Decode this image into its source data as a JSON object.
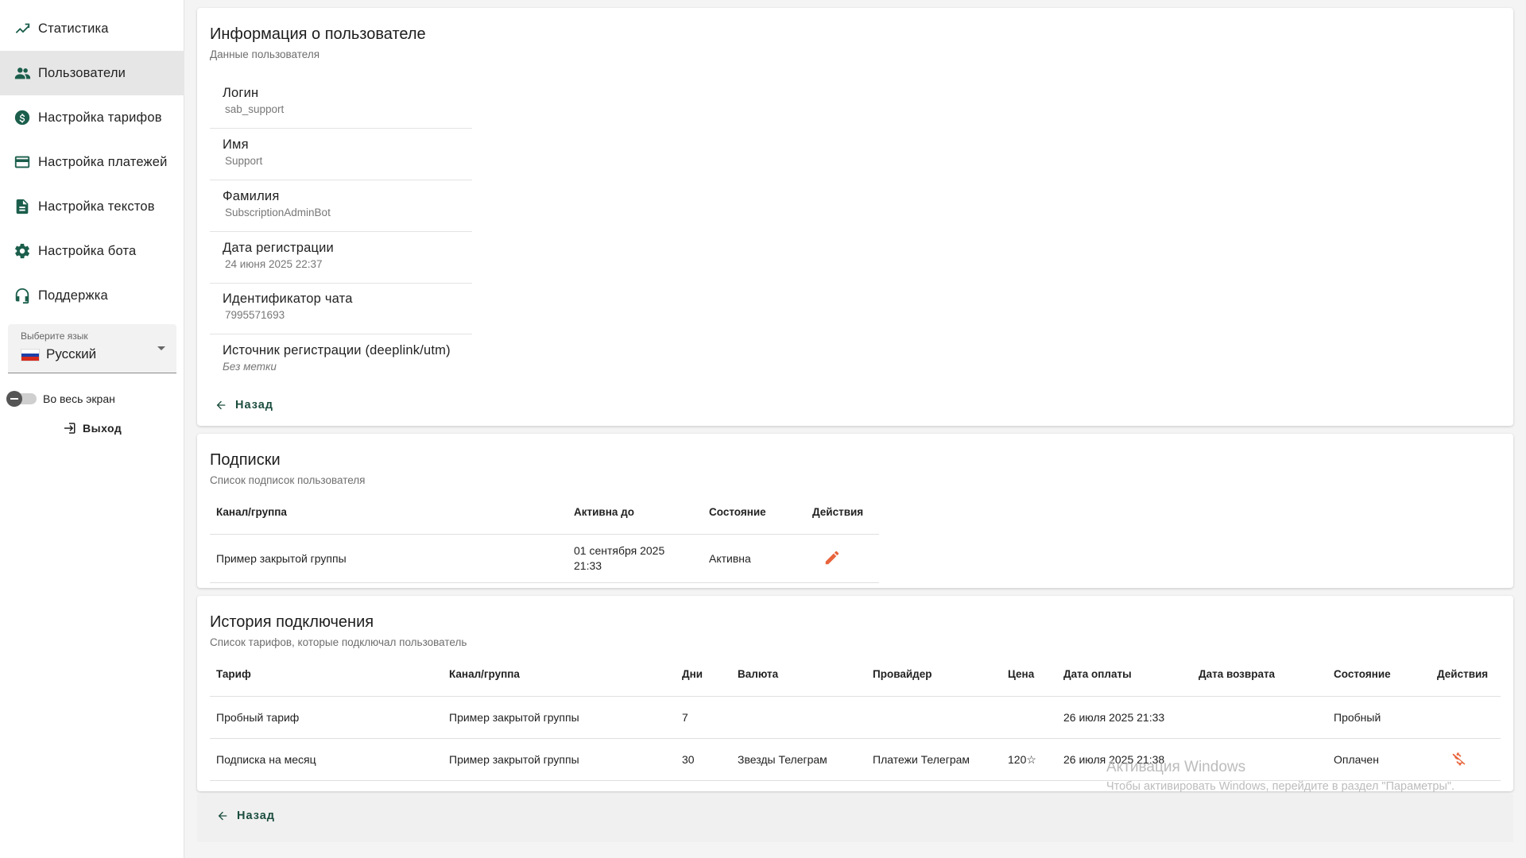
{
  "sidebar": {
    "items": [
      {
        "label": "Статистика",
        "icon": "chart-line-icon"
      },
      {
        "label": "Пользователи",
        "icon": "people-icon",
        "active": true
      },
      {
        "label": "Настройка тарифов",
        "icon": "dollar-circle-icon"
      },
      {
        "label": "Настройка платежей",
        "icon": "credit-card-icon"
      },
      {
        "label": "Настройка текстов",
        "icon": "document-icon"
      },
      {
        "label": "Настройка бота",
        "icon": "gear-icon"
      },
      {
        "label": "Поддержка",
        "icon": "headset-icon"
      }
    ],
    "language": {
      "label": "Выберите язык",
      "value": "Русский"
    },
    "fullscreen_label": "Во весь экран",
    "logout_label": "Выход"
  },
  "user_info": {
    "title": "Информация о пользователе",
    "subtitle": "Данные пользователя",
    "fields": [
      {
        "label": "Логин",
        "value": "sab_support"
      },
      {
        "label": "Имя",
        "value": "Support"
      },
      {
        "label": "Фамилия",
        "value": "SubscriptionAdminBot"
      },
      {
        "label": "Дата регистрации",
        "value": "24 июня 2025 22:37"
      },
      {
        "label": "Идентификатор чата",
        "value": "7995571693"
      },
      {
        "label": "Источник регистрации (deeplink/utm)",
        "value": "Без метки"
      }
    ],
    "back_label": "Назад"
  },
  "subscriptions": {
    "title": "Подписки",
    "subtitle": "Список подписок пользователя",
    "columns": [
      "Канал/группа",
      "Активна до",
      "Состояние",
      "Действия"
    ],
    "rows": [
      {
        "channel": "Пример закрытой группы",
        "active_until_line1": "01 сентября 2025",
        "active_until_line2": "21:33",
        "state": "Активна"
      }
    ]
  },
  "history": {
    "title": "История подключения",
    "subtitle": "Список тарифов, которые подключал пользователь",
    "columns": [
      "Тариф",
      "Канал/группа",
      "Дни",
      "Валюта",
      "Провайдер",
      "Цена",
      "Дата оплаты",
      "Дата возврата",
      "Состояние",
      "Действия"
    ],
    "rows": [
      {
        "tariff": "Пробный тариф",
        "channel": "Пример закрытой группы",
        "days": "7",
        "currency": "",
        "provider": "",
        "price": "",
        "paid": "26 июля 2025 21:33",
        "refund": "",
        "state": "Пробный"
      },
      {
        "tariff": "Подписка на месяц",
        "channel": "Пример закрытой группы",
        "days": "30",
        "currency": "Звезды Телеграм",
        "provider": "Платежи Телеграм",
        "price": "120☆",
        "paid": "26 июля 2025 21:38",
        "refund": "",
        "state": "Оплачен"
      }
    ]
  },
  "back_bottom_label": "Назад",
  "watermark": {
    "line1": "Активация Windows",
    "line2": "Чтобы активировать Windows, перейдите в раздел \"Параметры\"."
  },
  "colors": {
    "accent": "#1b4d3e",
    "action": "#e8643c",
    "active_nav": "#e6e6e6"
  }
}
